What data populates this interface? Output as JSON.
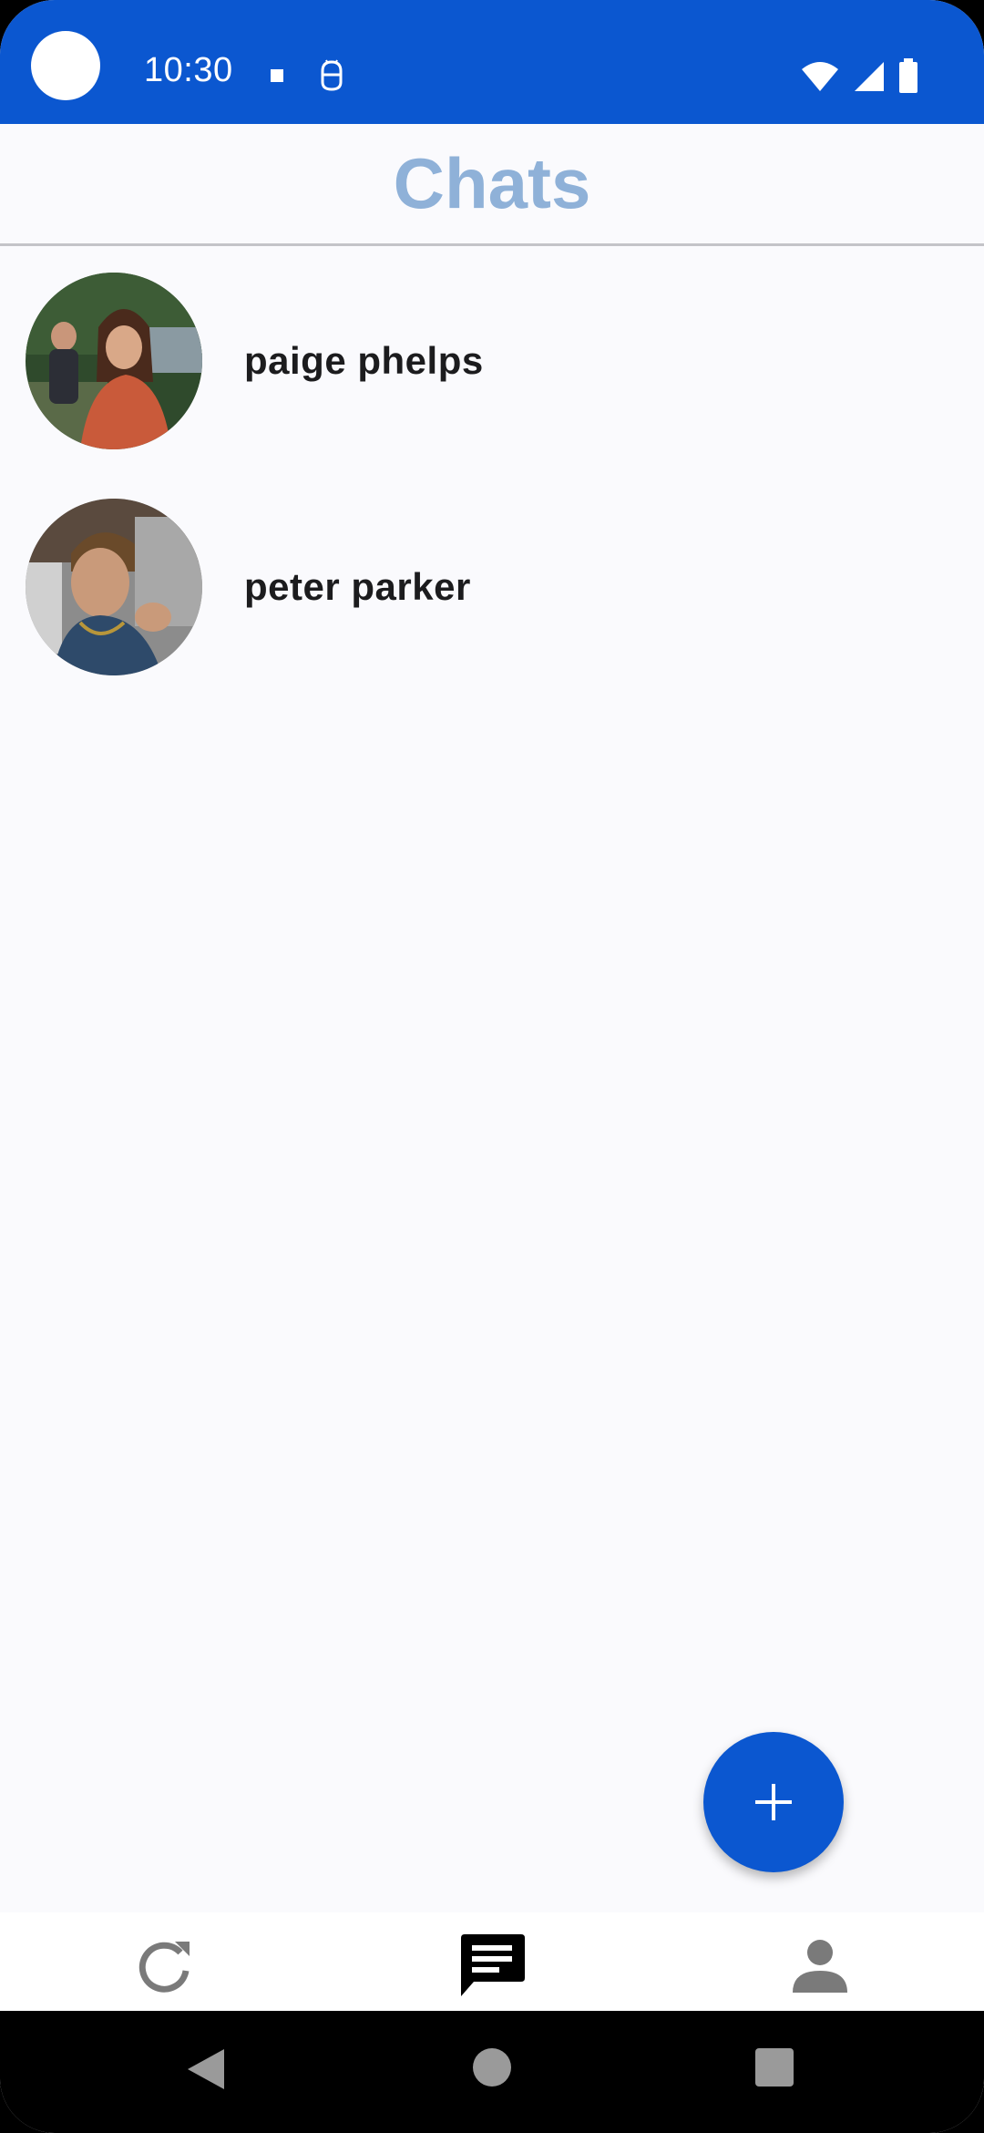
{
  "status_bar": {
    "time": "10:30"
  },
  "header": {
    "title": "Chats"
  },
  "chats": [
    {
      "name": "paige phelps"
    },
    {
      "name": "peter parker"
    }
  ],
  "fab": {
    "icon": "plus-icon"
  },
  "bottom_nav": {
    "items": [
      {
        "icon": "refresh-icon",
        "active": false
      },
      {
        "icon": "chat-icon",
        "active": true
      },
      {
        "icon": "person-icon",
        "active": false
      }
    ]
  },
  "colors": {
    "primary": "#0b57d0",
    "title": "#8fb1d8",
    "background": "#fafafd",
    "inactive_icon": "#7a7a7a"
  }
}
